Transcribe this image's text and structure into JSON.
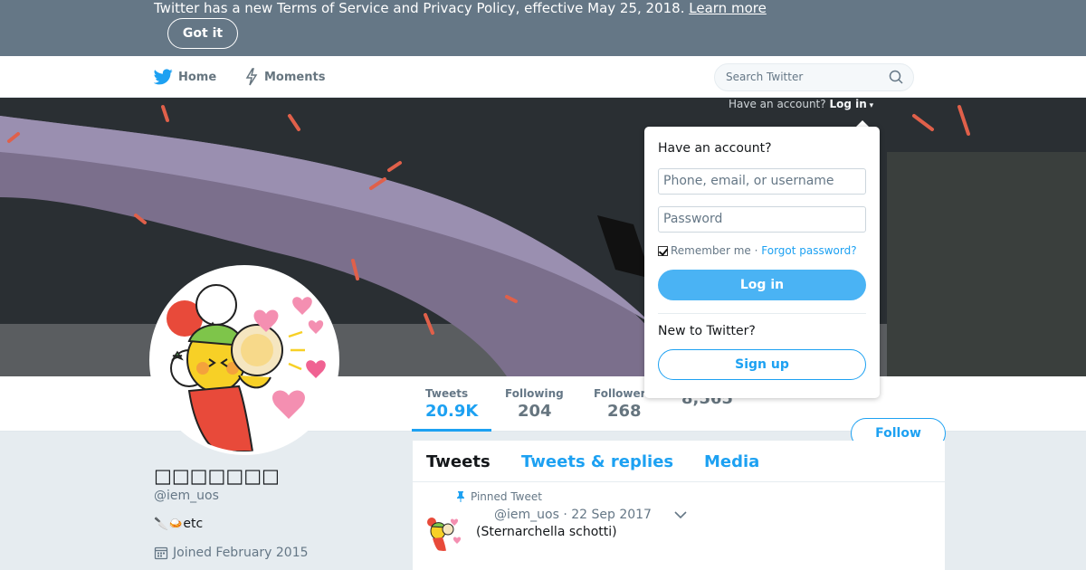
{
  "banner": {
    "text": "Twitter has a new Terms of Service and Privacy Policy, effective May 25, 2018.",
    "learn_more": "Learn more",
    "got_it": "Got it"
  },
  "nav": {
    "home": "Home",
    "moments": "Moments",
    "search_placeholder": "Search Twitter",
    "have_account": "Have an account?",
    "log_in_link": "Log in"
  },
  "login": {
    "title": "Have an account?",
    "username_placeholder": "Phone, email, or username",
    "password_placeholder": "Password",
    "remember": "Remember me",
    "separator": "·",
    "forgot": "Forgot password?",
    "login_button": "Log in",
    "new_to": "New to Twitter?",
    "signup_button": "Sign up"
  },
  "stats": [
    {
      "label": "Tweets",
      "value": "20.9K"
    },
    {
      "label": "Following",
      "value": "204"
    },
    {
      "label": "Followers",
      "value": "268"
    },
    {
      "label": "",
      "value": "8,565"
    }
  ],
  "follow": "Follow",
  "profile": {
    "name": "□□□□□□□",
    "handle": "@iem_uos",
    "bio": "etc",
    "joined": "Joined February 2015"
  },
  "timeline": {
    "tabs": [
      "Tweets",
      "Tweets & replies",
      "Media"
    ],
    "pinned_label": "Pinned Tweet",
    "tweet_handle": "@iem_uos",
    "tweet_date": "· 22 Sep 2017",
    "tweet_text": "(Sternarchella schotti)"
  },
  "colors": {
    "banner": "#657786",
    "accent": "#1da1f2",
    "login_button": "#4ab3f4"
  }
}
